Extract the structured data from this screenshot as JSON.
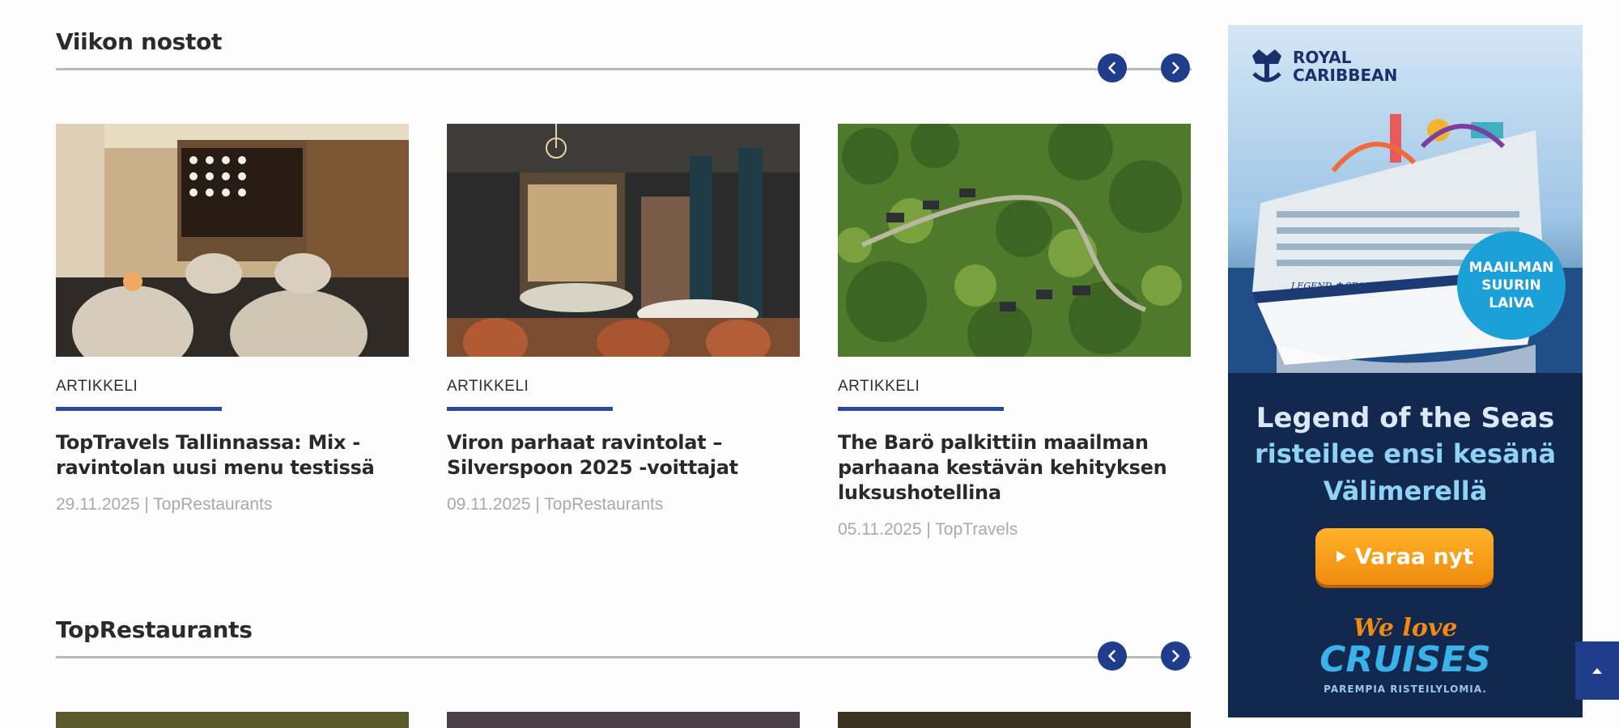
{
  "sections": [
    {
      "title": "Viikon nostot",
      "cards": [
        {
          "category": "ARTIKKELI",
          "title": "TopTravels Tallinnassa: Mix -ravintolan uusi menu testissä",
          "meta": "29.11.2025 | TopRestaurants"
        },
        {
          "category": "ARTIKKELI",
          "title": "Viron parhaat ravintolat – Silverspoon 2025 -voittajat",
          "meta": "09.11.2025 | TopRestaurants"
        },
        {
          "category": "ARTIKKELI",
          "title": "The Barö palkittiin maailman parhaana kestävän kehityksen luksushotellina",
          "meta": "05.11.2025 | TopTravels"
        }
      ]
    },
    {
      "title": "TopRestaurants"
    }
  ],
  "nav": {
    "prev_icon": "chevron-left-icon",
    "next_icon": "chevron-right-icon"
  },
  "ad": {
    "brand_line1": "ROYAL",
    "brand_line2": "CARIBBEAN",
    "badge_line1": "MAAILMAN",
    "badge_line2": "SUURIN",
    "badge_line3": "LAIVA",
    "ship_name": "LEGEND ✱ SEAS",
    "headline_line1": "Legend of the Seas",
    "headline_line2": "risteilee ensi kesänä",
    "headline_line3": "Välimerellä",
    "cta": "Varaa nyt",
    "footer_logo_line1": "We love",
    "footer_logo_line2": "CRUISES",
    "footer_tagline": "PAREMPIA RISTEILYLOMIA."
  },
  "colors": {
    "accent": "#1f3d8a",
    "rule": "#2a4a9c",
    "ad_bg": "#13284f",
    "headline_yellow": "#8fd3f4"
  }
}
